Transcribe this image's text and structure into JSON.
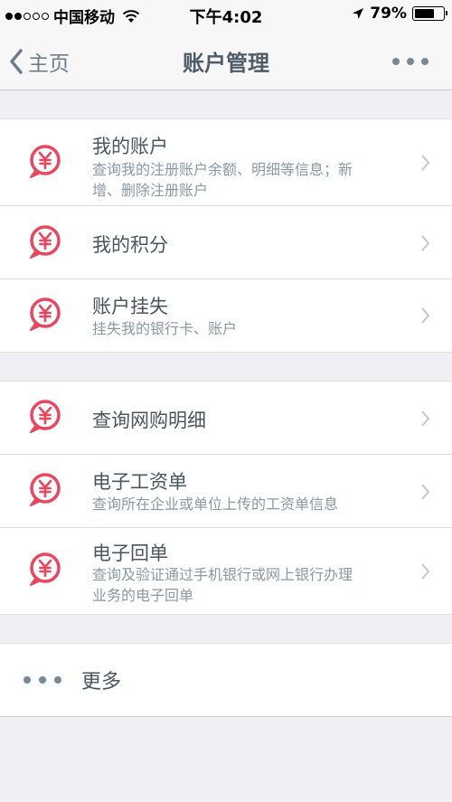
{
  "status_bar": {
    "carrier": "中国移动",
    "time": "下午4:02",
    "battery_percent": "79%",
    "battery_level": 0.79
  },
  "nav": {
    "back_label": "主页",
    "title": "账户管理"
  },
  "accent_color": "#e8475f",
  "groups": [
    {
      "items": [
        {
          "title": "我的账户",
          "subtitle_lines": [
            "查询我的注册账户余额、明细等信息；新",
            "增、删除注册账户"
          ]
        },
        {
          "title": "我的积分",
          "subtitle_lines": []
        },
        {
          "title": "账户挂失",
          "subtitle_lines": [
            "挂失我的银行卡、账户"
          ]
        }
      ]
    },
    {
      "items": [
        {
          "title": "查询网购明细",
          "subtitle_lines": []
        },
        {
          "title": "电子工资单",
          "subtitle_lines": [
            "查询所在企业或单位上传的工资单信息"
          ]
        },
        {
          "title": "电子回单",
          "subtitle_lines": [
            "查询及验证通过手机银行或网上银行办理",
            "业务的电子回单"
          ]
        }
      ]
    }
  ],
  "more": {
    "label": "更多"
  }
}
